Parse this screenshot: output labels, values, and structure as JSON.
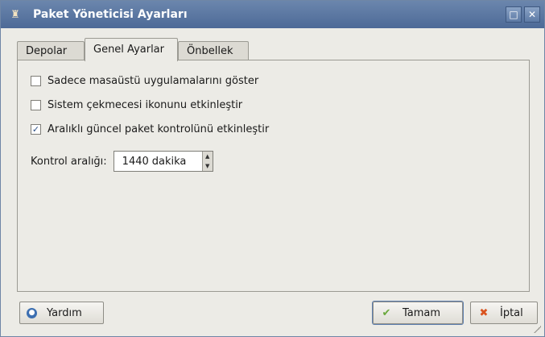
{
  "window": {
    "title": "Paket Yöneticisi Ayarları"
  },
  "tabs": [
    {
      "label": "Depolar"
    },
    {
      "label": "Genel Ayarlar",
      "active": true
    },
    {
      "label": "Önbellek"
    }
  ],
  "settings": {
    "option1": {
      "label": "Sadece masaüstü uygulamalarını göster",
      "checked": false
    },
    "option2": {
      "label": "Sistem çekmecesi ikonunu etkinleştir",
      "checked": false
    },
    "option3": {
      "label": "Aralıklı güncel paket kontrolünü etkinleştir",
      "checked": true
    },
    "interval": {
      "label": "Kontrol aralığı:",
      "value": "1440",
      "unit": "dakika"
    }
  },
  "buttons": {
    "help": "Yardım",
    "ok": "Tamam",
    "cancel": "İptal"
  },
  "icons": {
    "app": "package-icon",
    "help": "help-icon",
    "ok": "checkmark-icon",
    "cancel": "cancel-x-icon",
    "maximize": "maximize-icon",
    "close": "close-icon"
  }
}
